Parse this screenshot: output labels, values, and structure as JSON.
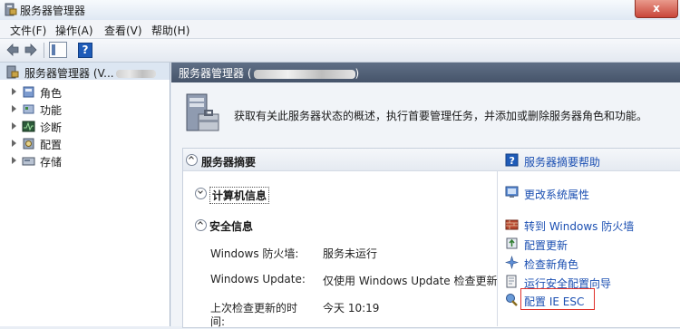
{
  "window": {
    "title": "服务器管理器",
    "close_label": "x"
  },
  "menu": [
    "文件(F)",
    "操作(A)",
    "查看(V)",
    "帮助(H)"
  ],
  "tree": {
    "root": "服务器管理器 (V...",
    "items": [
      "角色",
      "功能",
      "诊断",
      "配置",
      "存储"
    ]
  },
  "header": {
    "title": "服务器管理器 ("
  },
  "intro": "获取有关此服务器状态的概述，执行首要管理任务，并添加或删除服务器角色和功能。",
  "summary": {
    "title": "服务器摘要",
    "help_link": "服务器摘要帮助",
    "computer_info": {
      "title": "计算机信息",
      "link": "更改系统属性"
    },
    "security": {
      "title": "安全信息",
      "rows": [
        {
          "label": "Windows 防火墙:",
          "value": "服务未运行"
        },
        {
          "label": "Windows Update:",
          "value": "仅使用 Windows Update 检查更新"
        },
        {
          "label": "上次检查更新的时",
          "label2": "间:",
          "value": "今天 10:19"
        }
      ],
      "links": [
        "转到 Windows 防火墙",
        "配置更新",
        "检查新角色",
        "运行安全配置向导",
        "配置 IE ESC"
      ]
    }
  },
  "colors": {
    "link": "#1b4fb2",
    "highlight": "#e0302a",
    "header": "#4f5e75"
  }
}
